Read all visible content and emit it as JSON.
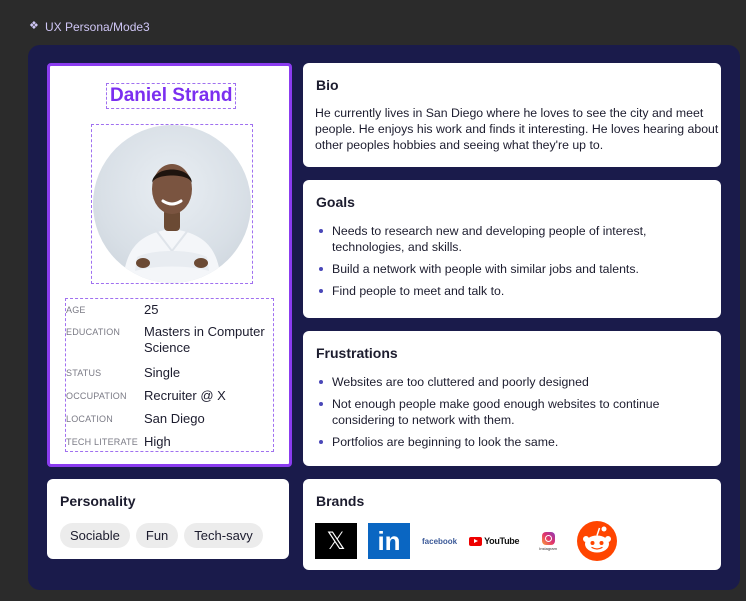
{
  "frame": {
    "label": "UX Persona/Mode3"
  },
  "profile": {
    "name": "Daniel Strand",
    "attributes": [
      {
        "label": "AGE",
        "value": "25"
      },
      {
        "label": "EDUCATION",
        "value": "Masters in Computer Science"
      },
      {
        "label": "STATUS",
        "value": "Single"
      },
      {
        "label": "OCCUPATION",
        "value": "Recruiter @ X"
      },
      {
        "label": "LOCATION",
        "value": "San Diego"
      },
      {
        "label": "TECH LITERATE",
        "value": "High"
      }
    ]
  },
  "personality": {
    "title": "Personality",
    "traits": [
      "Sociable",
      "Fun",
      "Tech-savy"
    ]
  },
  "bio": {
    "title": "Bio",
    "text": "He currently lives in San Diego where he loves to see the city and meet people. He enjoys his work and finds it interesting. He loves hearing about other peoples hobbies and seeing what they're up to."
  },
  "goals": {
    "title": "Goals",
    "items": [
      "Needs to research new and developing people of interest, technologies, and skills.",
      "Build a network with people with similar jobs and talents.",
      "Find people to meet and talk to."
    ]
  },
  "frustrations": {
    "title": "Frustrations",
    "items": [
      "Websites are too cluttered and poorly designed",
      "Not enough people make good enough websites to continue considering to network with them.",
      "Portfolios are beginning to look the same."
    ]
  },
  "brands": {
    "title": "Brands",
    "logos": {
      "x": "𝕏",
      "linkedin": "in",
      "facebook": "facebook",
      "youtube": "YouTube",
      "instagram": "Instagram"
    }
  },
  "colors": {
    "canvas": "#1a1b4b",
    "accent": "#7b2ff0",
    "selection": "#8b3cf0",
    "bullet": "#4a48b8"
  }
}
